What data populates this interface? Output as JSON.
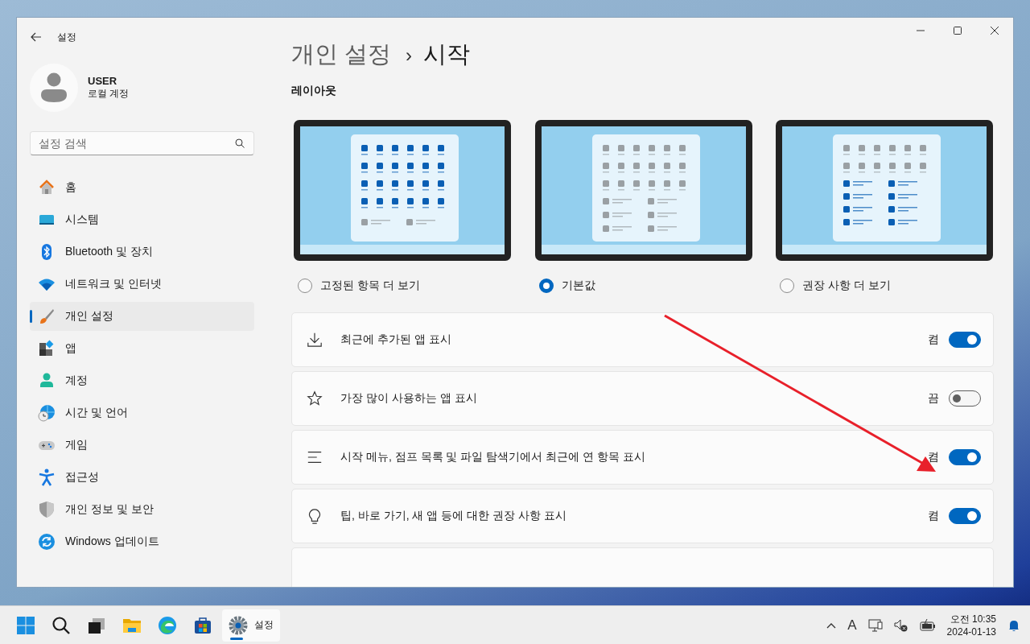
{
  "window": {
    "title": "설정"
  },
  "account": {
    "name": "USER",
    "type": "로컬 계정"
  },
  "search": {
    "placeholder": "설정 검색"
  },
  "nav": [
    {
      "label": "홈",
      "selected": false
    },
    {
      "label": "시스템",
      "selected": false
    },
    {
      "label": "Bluetooth 및 장치",
      "selected": false
    },
    {
      "label": "네트워크 및 인터넷",
      "selected": false
    },
    {
      "label": "개인 설정",
      "selected": true
    },
    {
      "label": "앱",
      "selected": false
    },
    {
      "label": "계정",
      "selected": false
    },
    {
      "label": "시간 및 언어",
      "selected": false
    },
    {
      "label": "게임",
      "selected": false
    },
    {
      "label": "접근성",
      "selected": false
    },
    {
      "label": "개인 정보 및 보안",
      "selected": false
    },
    {
      "label": "Windows 업데이트",
      "selected": false
    }
  ],
  "breadcrumb": {
    "parent": "개인 설정",
    "separator": "›",
    "current": "시작"
  },
  "layout": {
    "heading": "레이아웃",
    "options": [
      {
        "kind": "pins",
        "label": "고정된 항목 더 보기",
        "selected": false
      },
      {
        "kind": "default",
        "label": "기본값",
        "selected": true
      },
      {
        "kind": "recommendations",
        "label": "권장 사항 더 보기",
        "selected": false
      }
    ]
  },
  "settings": [
    {
      "label": "최근에 추가된 앱 표시",
      "state_label": "켬",
      "on": true
    },
    {
      "label": "가장 많이 사용하는 앱 표시",
      "state_label": "끔",
      "on": false
    },
    {
      "label": "시작 메뉴, 점프 목록 및 파일 탐색기에서 최근에 연 항목 표시",
      "state_label": "켬",
      "on": true
    },
    {
      "label": "팁, 바로 가기, 새 앱 등에 대한 권장 사항 표시",
      "state_label": "켬",
      "on": true
    }
  ],
  "taskbar": {
    "apps": [
      {
        "label": "설정",
        "selected": true
      }
    ],
    "ime": "A",
    "time": "오전 10:35",
    "date": "2024-01-13"
  }
}
